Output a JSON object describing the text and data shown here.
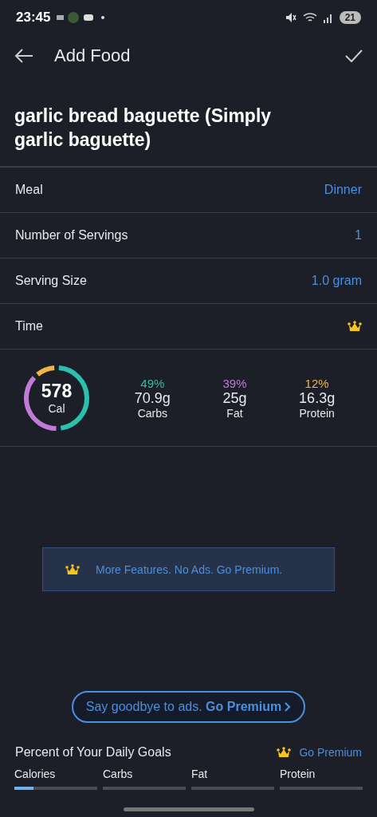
{
  "status_bar": {
    "time": "23:45",
    "battery": "21"
  },
  "header": {
    "title": "Add Food"
  },
  "food_name": "garlic bread baguette (Simply garlic baguette)",
  "fields": [
    {
      "label": "Meal",
      "value": "Dinner",
      "kind": "text"
    },
    {
      "label": "Number of Servings",
      "value": "1",
      "kind": "text"
    },
    {
      "label": "Serving Size",
      "value": "1.0 gram",
      "kind": "text"
    },
    {
      "label": "Time",
      "kind": "premium"
    }
  ],
  "calories": {
    "value": "578",
    "unit": "Cal"
  },
  "macros": [
    {
      "percent": "49%",
      "amount": "70.9g",
      "name": "Carbs",
      "color": "#2bbfae"
    },
    {
      "percent": "39%",
      "amount": "25g",
      "name": "Fat",
      "color": "#c27ad8"
    },
    {
      "percent": "12%",
      "amount": "16.3g",
      "name": "Protein",
      "color": "#f2b544"
    }
  ],
  "banner": {
    "text": "More Features. No Ads. Go Premium."
  },
  "premium_pill": {
    "text": "Say goodbye to ads. **Go Premium**"
  },
  "goals": {
    "title": "Percent of Your Daily Goals",
    "link": "Go Premium",
    "items": [
      {
        "label": "Calories",
        "level": 0.23
      },
      {
        "label": "Carbs",
        "level": 0
      },
      {
        "label": "Fat",
        "level": 0
      },
      {
        "label": "Protein",
        "level": 0
      }
    ]
  }
}
